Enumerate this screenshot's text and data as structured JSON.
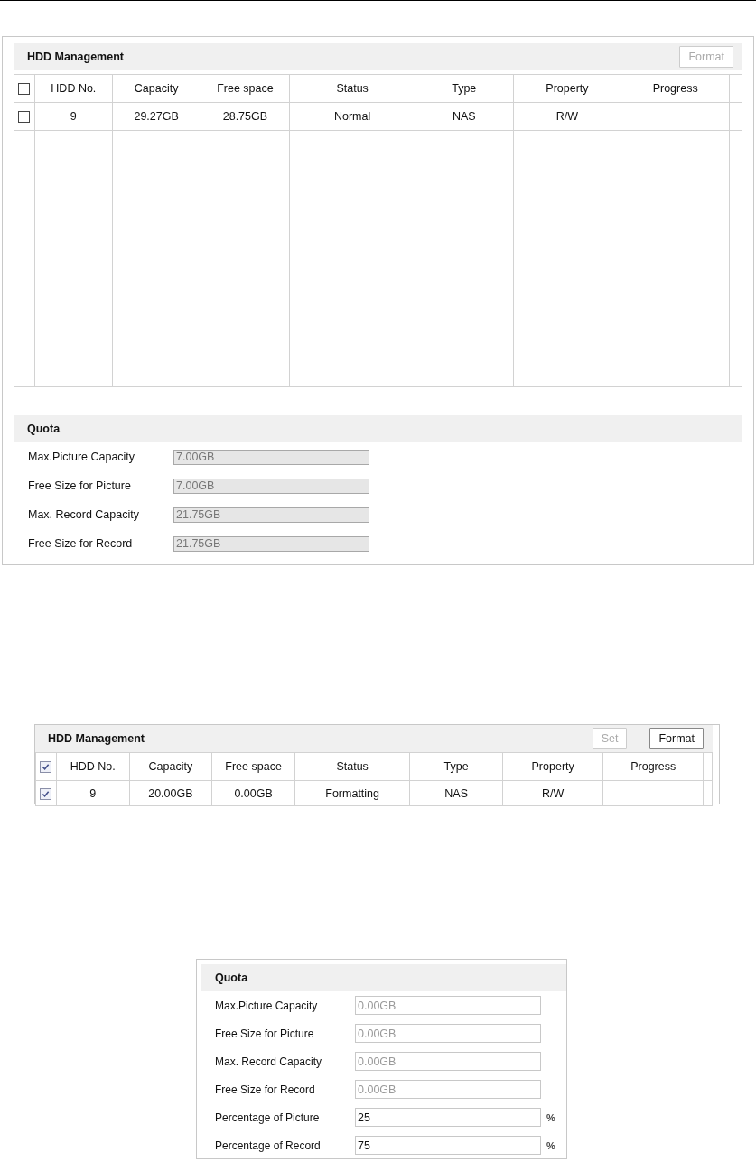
{
  "figures": [
    {
      "sections": [
        {
          "kind": "hdd",
          "title": "HDD Management",
          "buttons": [
            {
              "label": "Format",
              "disabled": true
            }
          ],
          "header_checked": false,
          "columns": [
            "HDD No.",
            "Capacity",
            "Free space",
            "Status",
            "Type",
            "Property",
            "Progress"
          ],
          "rows": [
            {
              "checked": false,
              "cells": [
                "9",
                "29.27GB",
                "28.75GB",
                "Normal",
                "NAS",
                "R/W",
                ""
              ]
            }
          ]
        },
        {
          "kind": "quota",
          "title": "Quota",
          "fields": [
            {
              "label": "Max.Picture Capacity",
              "value": "7.00GB",
              "disabled": true
            },
            {
              "label": "Free Size for Picture",
              "value": "7.00GB",
              "disabled": true
            },
            {
              "label": "Max. Record Capacity",
              "value": "21.75GB",
              "disabled": true
            },
            {
              "label": "Free Size for Record",
              "value": "21.75GB",
              "disabled": true
            }
          ]
        }
      ]
    },
    {
      "sections": [
        {
          "kind": "hdd",
          "title": "HDD Management",
          "buttons": [
            {
              "label": "Set",
              "disabled": true
            },
            {
              "label": "Format",
              "disabled": false
            }
          ],
          "header_checked": true,
          "columns": [
            "HDD No.",
            "Capacity",
            "Free space",
            "Status",
            "Type",
            "Property",
            "Progress"
          ],
          "rows": [
            {
              "checked": true,
              "cells": [
                "9",
                "20.00GB",
                "0.00GB",
                "Formatting",
                "NAS",
                "R/W",
                ""
              ]
            }
          ]
        }
      ]
    },
    {
      "sections": [
        {
          "kind": "quota",
          "title": "Quota",
          "fields": [
            {
              "label": "Max.Picture Capacity",
              "value": "0.00GB",
              "disabled": true
            },
            {
              "label": "Free Size for Picture",
              "value": "0.00GB",
              "disabled": true
            },
            {
              "label": "Max. Record Capacity",
              "value": "0.00GB",
              "disabled": true
            },
            {
              "label": "Free Size for Record",
              "value": "0.00GB",
              "disabled": true
            },
            {
              "label": "Percentage of Picture",
              "value": "25",
              "disabled": false,
              "unit": "%"
            },
            {
              "label": "Percentage of Record",
              "value": "75",
              "disabled": false,
              "unit": "%"
            }
          ]
        }
      ]
    }
  ]
}
